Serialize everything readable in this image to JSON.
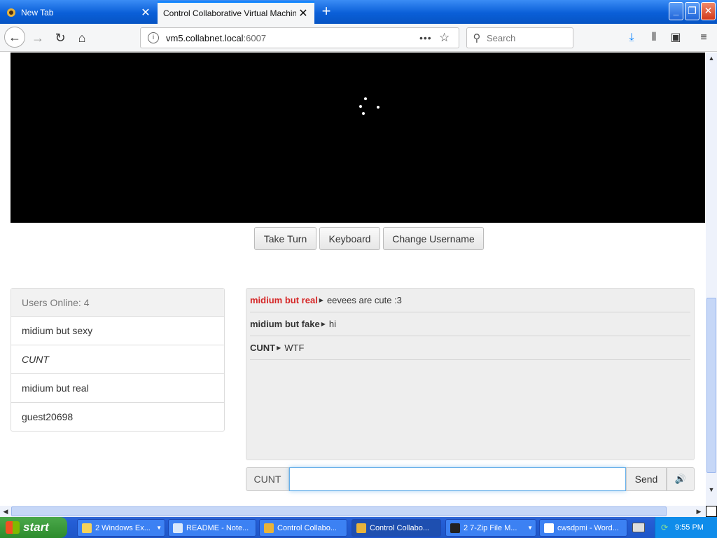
{
  "browser": {
    "tabs": [
      {
        "title": "New Tab",
        "active": false
      },
      {
        "title": "Control Collaborative Virtual Machines!",
        "active": true
      }
    ],
    "url": {
      "host": "vm5.collabnet.local",
      "port": ":6007"
    },
    "search_placeholder": "Search"
  },
  "controls": {
    "take_turn": "Take Turn",
    "keyboard": "Keyboard",
    "change_username": "Change Username"
  },
  "users": {
    "header": "Users Online: 4",
    "list": [
      "midium but sexy",
      "CUNT",
      "midium but real",
      "guest20698"
    ]
  },
  "chat": {
    "messages": [
      {
        "user": "midium but real",
        "text": "eevees are cute :3",
        "highlight": true
      },
      {
        "user": "midium but fake",
        "text": "hi",
        "highlight": false
      },
      {
        "user": "CUNT",
        "text": "WTF",
        "highlight": false
      }
    ],
    "input_addon": "CUNT",
    "input_value": "",
    "send_label": "Send"
  },
  "taskbar": {
    "start_label": "start",
    "tasks": [
      {
        "label": "2 Windows Ex...",
        "active": false
      },
      {
        "label": "README - Note...",
        "active": false
      },
      {
        "label": "Control Collabo...",
        "active": false
      },
      {
        "label": "Control Collabo...",
        "active": true
      },
      {
        "label": "2 7-Zip File M...",
        "active": false
      },
      {
        "label": "cwsdpmi - Word...",
        "active": false
      }
    ],
    "clock": "9:55 PM"
  },
  "colors": {
    "accent_blue": "#0a84ff",
    "highlight_red": "#d52626",
    "vm_background": "#000000"
  }
}
